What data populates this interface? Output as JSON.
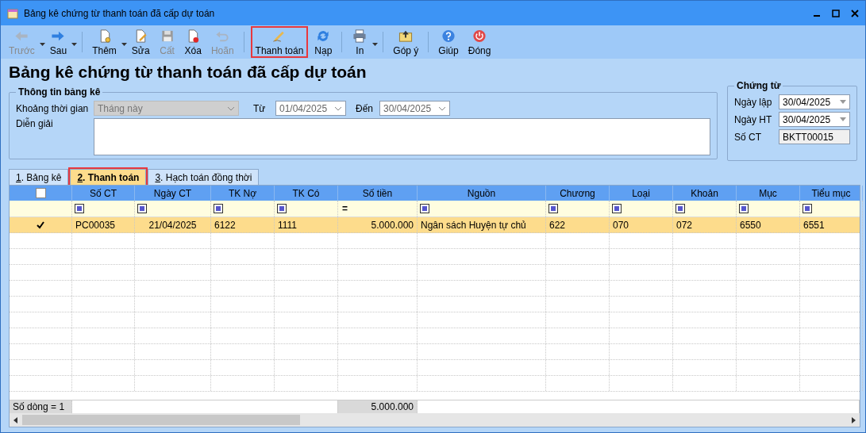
{
  "window": {
    "title": "Bảng kê chứng từ thanh toán đã cấp dự toán"
  },
  "toolbar": [
    {
      "label": "Trước",
      "disabled": true,
      "dropdown": true,
      "highlighted": false,
      "separator_before": false
    },
    {
      "label": "Sau",
      "disabled": false,
      "dropdown": true,
      "highlighted": false,
      "separator_before": false
    },
    {
      "label": "Thêm",
      "disabled": false,
      "dropdown": true,
      "highlighted": false,
      "separator_before": true
    },
    {
      "label": "Sửa",
      "disabled": false,
      "dropdown": false,
      "highlighted": false,
      "separator_before": false
    },
    {
      "label": "Cất",
      "disabled": true,
      "dropdown": false,
      "highlighted": false,
      "separator_before": false
    },
    {
      "label": "Xóa",
      "disabled": false,
      "dropdown": false,
      "highlighted": false,
      "separator_before": false
    },
    {
      "label": "Hoãn",
      "disabled": true,
      "dropdown": false,
      "highlighted": false,
      "separator_before": false
    },
    {
      "label": "Thanh toán",
      "disabled": false,
      "dropdown": false,
      "highlighted": true,
      "separator_before": true
    },
    {
      "label": "Nạp",
      "disabled": false,
      "dropdown": false,
      "highlighted": false,
      "separator_before": false
    },
    {
      "label": "In",
      "disabled": false,
      "dropdown": true,
      "highlighted": false,
      "separator_before": true
    },
    {
      "label": "Góp ý",
      "disabled": false,
      "dropdown": false,
      "highlighted": false,
      "separator_before": true
    },
    {
      "label": "Giúp",
      "disabled": false,
      "dropdown": false,
      "highlighted": false,
      "separator_before": true
    },
    {
      "label": "Đóng",
      "disabled": false,
      "dropdown": false,
      "highlighted": false,
      "separator_before": false
    }
  ],
  "heading": "Bảng kê chứng từ thanh toán đã cấp dự toán",
  "info_group": {
    "title": "Thông tin bảng kê",
    "period_label": "Khoảng thời gian",
    "period_value": "Tháng này",
    "period_disabled": true,
    "from_label": "Từ",
    "from_value": "01/04/2025",
    "to_label": "Đến",
    "to_value": "30/04/2025",
    "description_label": "Diễn giải"
  },
  "voucher_group": {
    "title": "Chứng từ",
    "fields": [
      {
        "label": "Ngày lập",
        "value": "30/04/2025",
        "kind": "date"
      },
      {
        "label": "Ngày HT",
        "value": "30/04/2025",
        "kind": "date"
      },
      {
        "label": "Số CT",
        "value": "BKTT00015",
        "kind": "readonly"
      }
    ]
  },
  "tabs": [
    {
      "key": "1",
      "label": ". Bảng kê",
      "selected": false,
      "highlighted": false
    },
    {
      "key": "2",
      "label": ". Thanh toán",
      "selected": true,
      "highlighted": true
    },
    {
      "key": "3",
      "label": ". Hạch toán đồng thời",
      "selected": false,
      "highlighted": false
    }
  ],
  "table": {
    "all_checked": false,
    "columns": [
      {
        "label": "Số CT"
      },
      {
        "label": "Ngày CT"
      },
      {
        "label": "TK Nợ"
      },
      {
        "label": "TK Có"
      },
      {
        "label": "Số tiền",
        "filter": "="
      },
      {
        "label": "Nguồn"
      },
      {
        "label": "Chương"
      },
      {
        "label": "Loại"
      },
      {
        "label": "Khoản"
      },
      {
        "label": "Mục"
      },
      {
        "label": "Tiểu mục"
      }
    ],
    "rows": [
      {
        "checked": true,
        "selected": true,
        "cells": [
          "PC00035",
          "21/04/2025",
          "6122",
          "1111",
          "5.000.000",
          "Ngân sách Huyện tự chủ",
          "622",
          "070",
          "072",
          "6550",
          "6551"
        ]
      }
    ],
    "footer": {
      "count": "Số dòng = 1",
      "total": "5.000.000"
    }
  }
}
